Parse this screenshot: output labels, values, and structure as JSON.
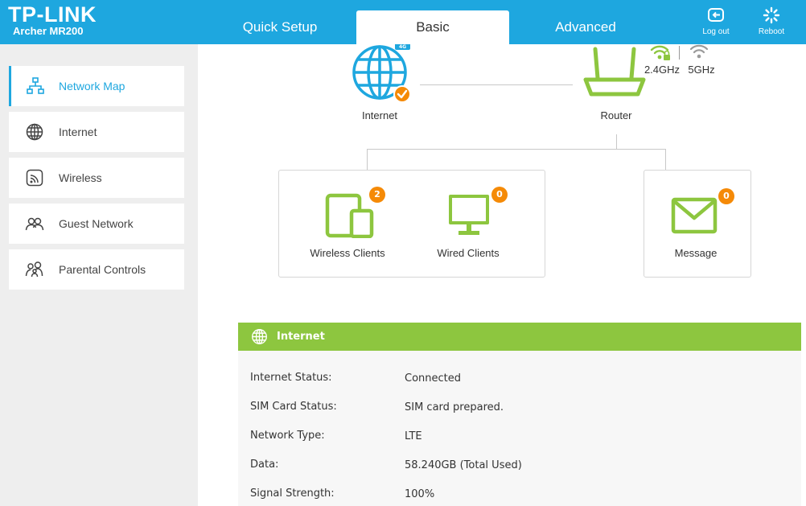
{
  "brand": {
    "logo_text": "TP-LINK",
    "model": "Archer MR200"
  },
  "nav": {
    "tabs": [
      {
        "label": "Quick Setup",
        "active": false
      },
      {
        "label": "Basic",
        "active": true
      },
      {
        "label": "Advanced",
        "active": false
      }
    ],
    "logout_label": "Log out",
    "reboot_label": "Reboot"
  },
  "sidebar": {
    "items": [
      {
        "label": "Network Map",
        "icon": "network-map-icon",
        "active": true
      },
      {
        "label": "Internet",
        "icon": "globe-icon",
        "active": false
      },
      {
        "label": "Wireless",
        "icon": "wireless-icon",
        "active": false
      },
      {
        "label": "Guest Network",
        "icon": "guest-network-icon",
        "active": false
      },
      {
        "label": "Parental Controls",
        "icon": "parental-controls-icon",
        "active": false
      }
    ]
  },
  "network_map": {
    "internet_label": "Internet",
    "internet_badge": "4G",
    "router_label": "Router",
    "band_24": "2.4GHz",
    "band_5": "5GHz",
    "wireless_clients_label": "Wireless Clients",
    "wireless_clients_count": "2",
    "wired_clients_label": "Wired Clients",
    "wired_clients_count": "0",
    "message_label": "Message",
    "message_count": "0"
  },
  "internet_panel": {
    "title": "Internet",
    "rows": [
      {
        "label": "Internet Status:",
        "value": "Connected"
      },
      {
        "label": "SIM Card Status:",
        "value": "SIM card prepared."
      },
      {
        "label": "Network Type:",
        "value": "LTE"
      },
      {
        "label": "Data:",
        "value": "58.240GB (Total Used)"
      },
      {
        "label": "Signal Strength:",
        "value": "100%"
      }
    ]
  },
  "colors": {
    "header_blue": "#1ea7df",
    "accent_green": "#8dc63f",
    "badge_orange": "#f58a07"
  }
}
